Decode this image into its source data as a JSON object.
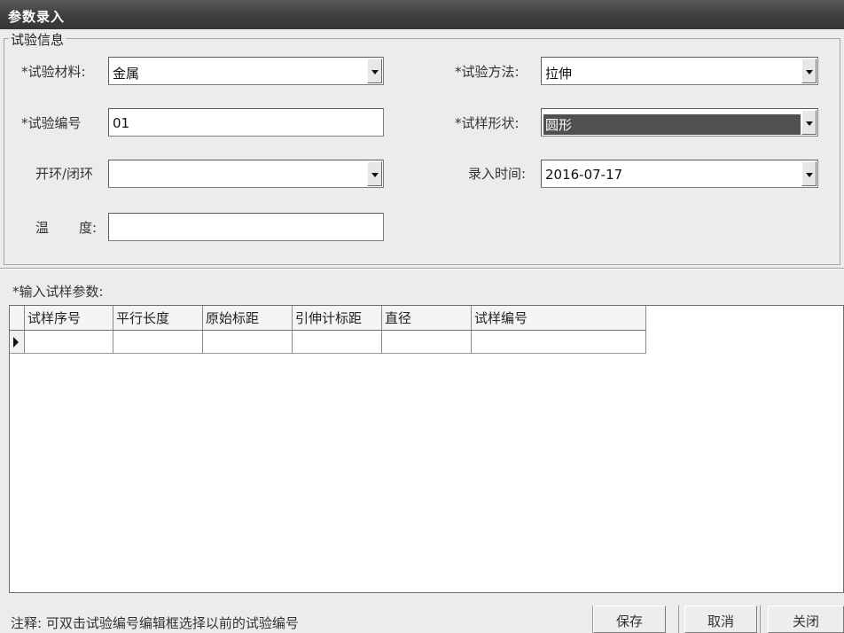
{
  "window": {
    "title": "参数录入"
  },
  "group": {
    "legend": "试验信息",
    "material": {
      "label": "*试验材料:",
      "value": "金属"
    },
    "method": {
      "label": "*试验方法:",
      "value": "拉伸"
    },
    "test_no": {
      "label": "*试验编号",
      "value": "01"
    },
    "shape": {
      "label": "*试样形状:",
      "value": "圆形"
    },
    "loop": {
      "label": "开环/闭环",
      "value": ""
    },
    "entry_time": {
      "label": "录入时间:",
      "value": "2016-07-17"
    },
    "temp": {
      "label_a": "温",
      "label_b": "度:",
      "value": ""
    }
  },
  "params": {
    "label": "*输入试样参数:",
    "columns": [
      "试样序号",
      "平行长度",
      "原始标距",
      "引伸计标距",
      "直径",
      "试样编号"
    ]
  },
  "footer": {
    "note": "注释: 可双击试验编号编辑框选择以前的试验编号",
    "save": "保存",
    "cancel": "取消",
    "close": "关闭"
  }
}
